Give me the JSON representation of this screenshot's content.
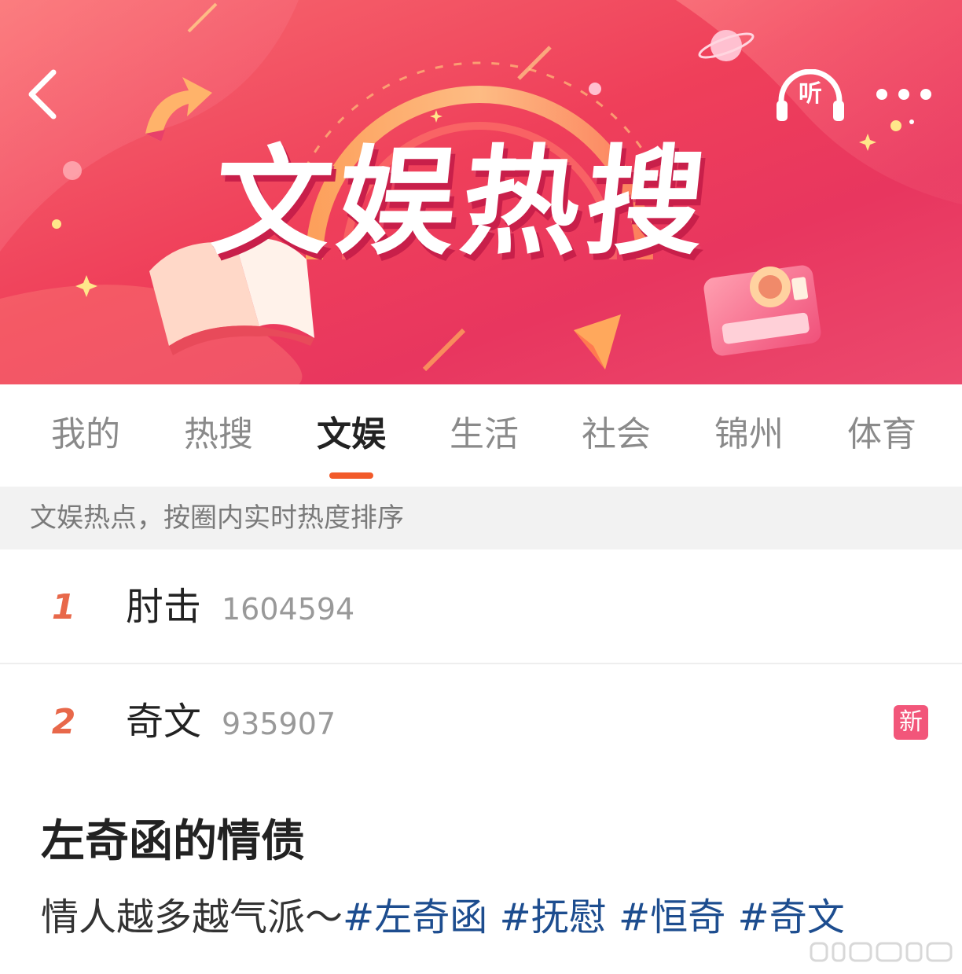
{
  "banner": {
    "title": "文娱热搜",
    "listen_label": "听"
  },
  "tabs": [
    {
      "label": "我的",
      "active": false
    },
    {
      "label": "热搜",
      "active": false
    },
    {
      "label": "文娱",
      "active": true
    },
    {
      "label": "生活",
      "active": false
    },
    {
      "label": "社会",
      "active": false
    },
    {
      "label": "锦州",
      "active": false
    },
    {
      "label": "体育",
      "active": false
    }
  ],
  "subtitle": "文娱热点，按圈内实时热度排序",
  "list": [
    {
      "rank": "1",
      "title": "肘击",
      "count": "1604594",
      "badge": ""
    },
    {
      "rank": "2",
      "title": "奇文",
      "count": "935907",
      "badge": "新"
    }
  ],
  "post": {
    "title": "左奇函的情债",
    "body_text": "情人越多越气派～",
    "hashtags": [
      "#左奇函",
      "#抚慰",
      "#恒奇",
      "#奇文"
    ]
  },
  "colors": {
    "banner_main": "#ef3f5a",
    "accent_orange": "#f25a2a",
    "rank_color": "#e8684a",
    "badge_new": "#f2567a",
    "hashtag": "#1d4d8f"
  },
  "icons": [
    "back-icon",
    "headphones-icon",
    "more-icon",
    "book-icon",
    "camera-icon",
    "arrow-icon",
    "planet-icon"
  ]
}
